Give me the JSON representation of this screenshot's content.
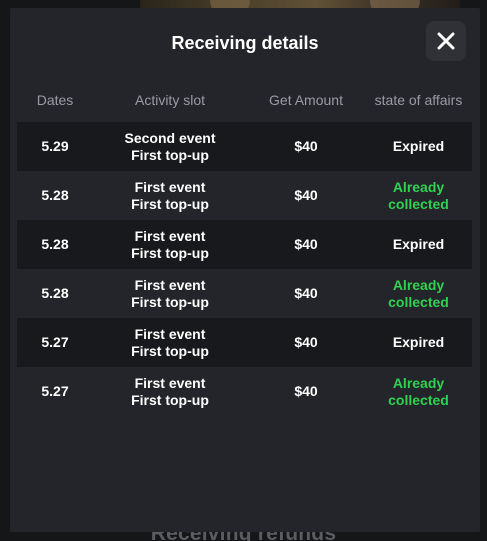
{
  "modal": {
    "title": "Receiving details",
    "close_label": "close"
  },
  "background": {
    "section_title": "Receiving refunds"
  },
  "table": {
    "columns": [
      "Dates",
      "Activity slot",
      "Get Amount",
      "state of affairs"
    ],
    "rows": [
      {
        "date": "5.29",
        "event": "Second event",
        "slot": "First top-up",
        "amount": "$40",
        "status": "Expired",
        "status_type": "expired"
      },
      {
        "date": "5.28",
        "event": "First event",
        "slot": "First top-up",
        "amount": "$40",
        "status": "Already collected",
        "status_type": "collected"
      },
      {
        "date": "5.28",
        "event": "First event",
        "slot": "First top-up",
        "amount": "$40",
        "status": "Expired",
        "status_type": "expired"
      },
      {
        "date": "5.28",
        "event": "First event",
        "slot": "First top-up",
        "amount": "$40",
        "status": "Already collected",
        "status_type": "collected"
      },
      {
        "date": "5.27",
        "event": "First event",
        "slot": "First top-up",
        "amount": "$40",
        "status": "Expired",
        "status_type": "expired"
      },
      {
        "date": "5.27",
        "event": "First event",
        "slot": "First top-up",
        "amount": "$40",
        "status": "Already collected",
        "status_type": "collected"
      }
    ]
  },
  "colors": {
    "modal_bg": "#24252a",
    "row_dark": "#18191c",
    "collected": "#2ed24f",
    "header_text": "#9a9ca3"
  }
}
